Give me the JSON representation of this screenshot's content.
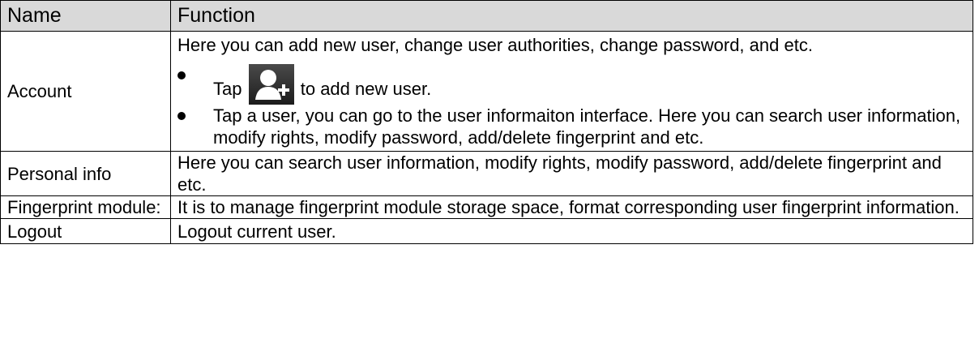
{
  "table": {
    "headers": [
      "Name",
      "Function"
    ],
    "rows": [
      {
        "name": "Account",
        "intro": "Here you can add new user, change user authorities, change password, and etc.",
        "bullet1_before": "Tap",
        "bullet1_icon": "add-user-icon",
        "bullet1_after": "to add new user.",
        "bullet2": "Tap a user, you can go to the user informaiton interface. Here you can search user information, modify rights, modify password, add/delete fingerprint and etc."
      },
      {
        "name": "Personal info",
        "function": "Here you can search user information, modify rights, modify password, add/delete fingerprint and etc."
      },
      {
        "name": "Fingerprint module:",
        "function": "It is to manage fingerprint module storage space, format corresponding user fingerprint information."
      },
      {
        "name": "Logout",
        "function": "Logout current user."
      }
    ]
  }
}
